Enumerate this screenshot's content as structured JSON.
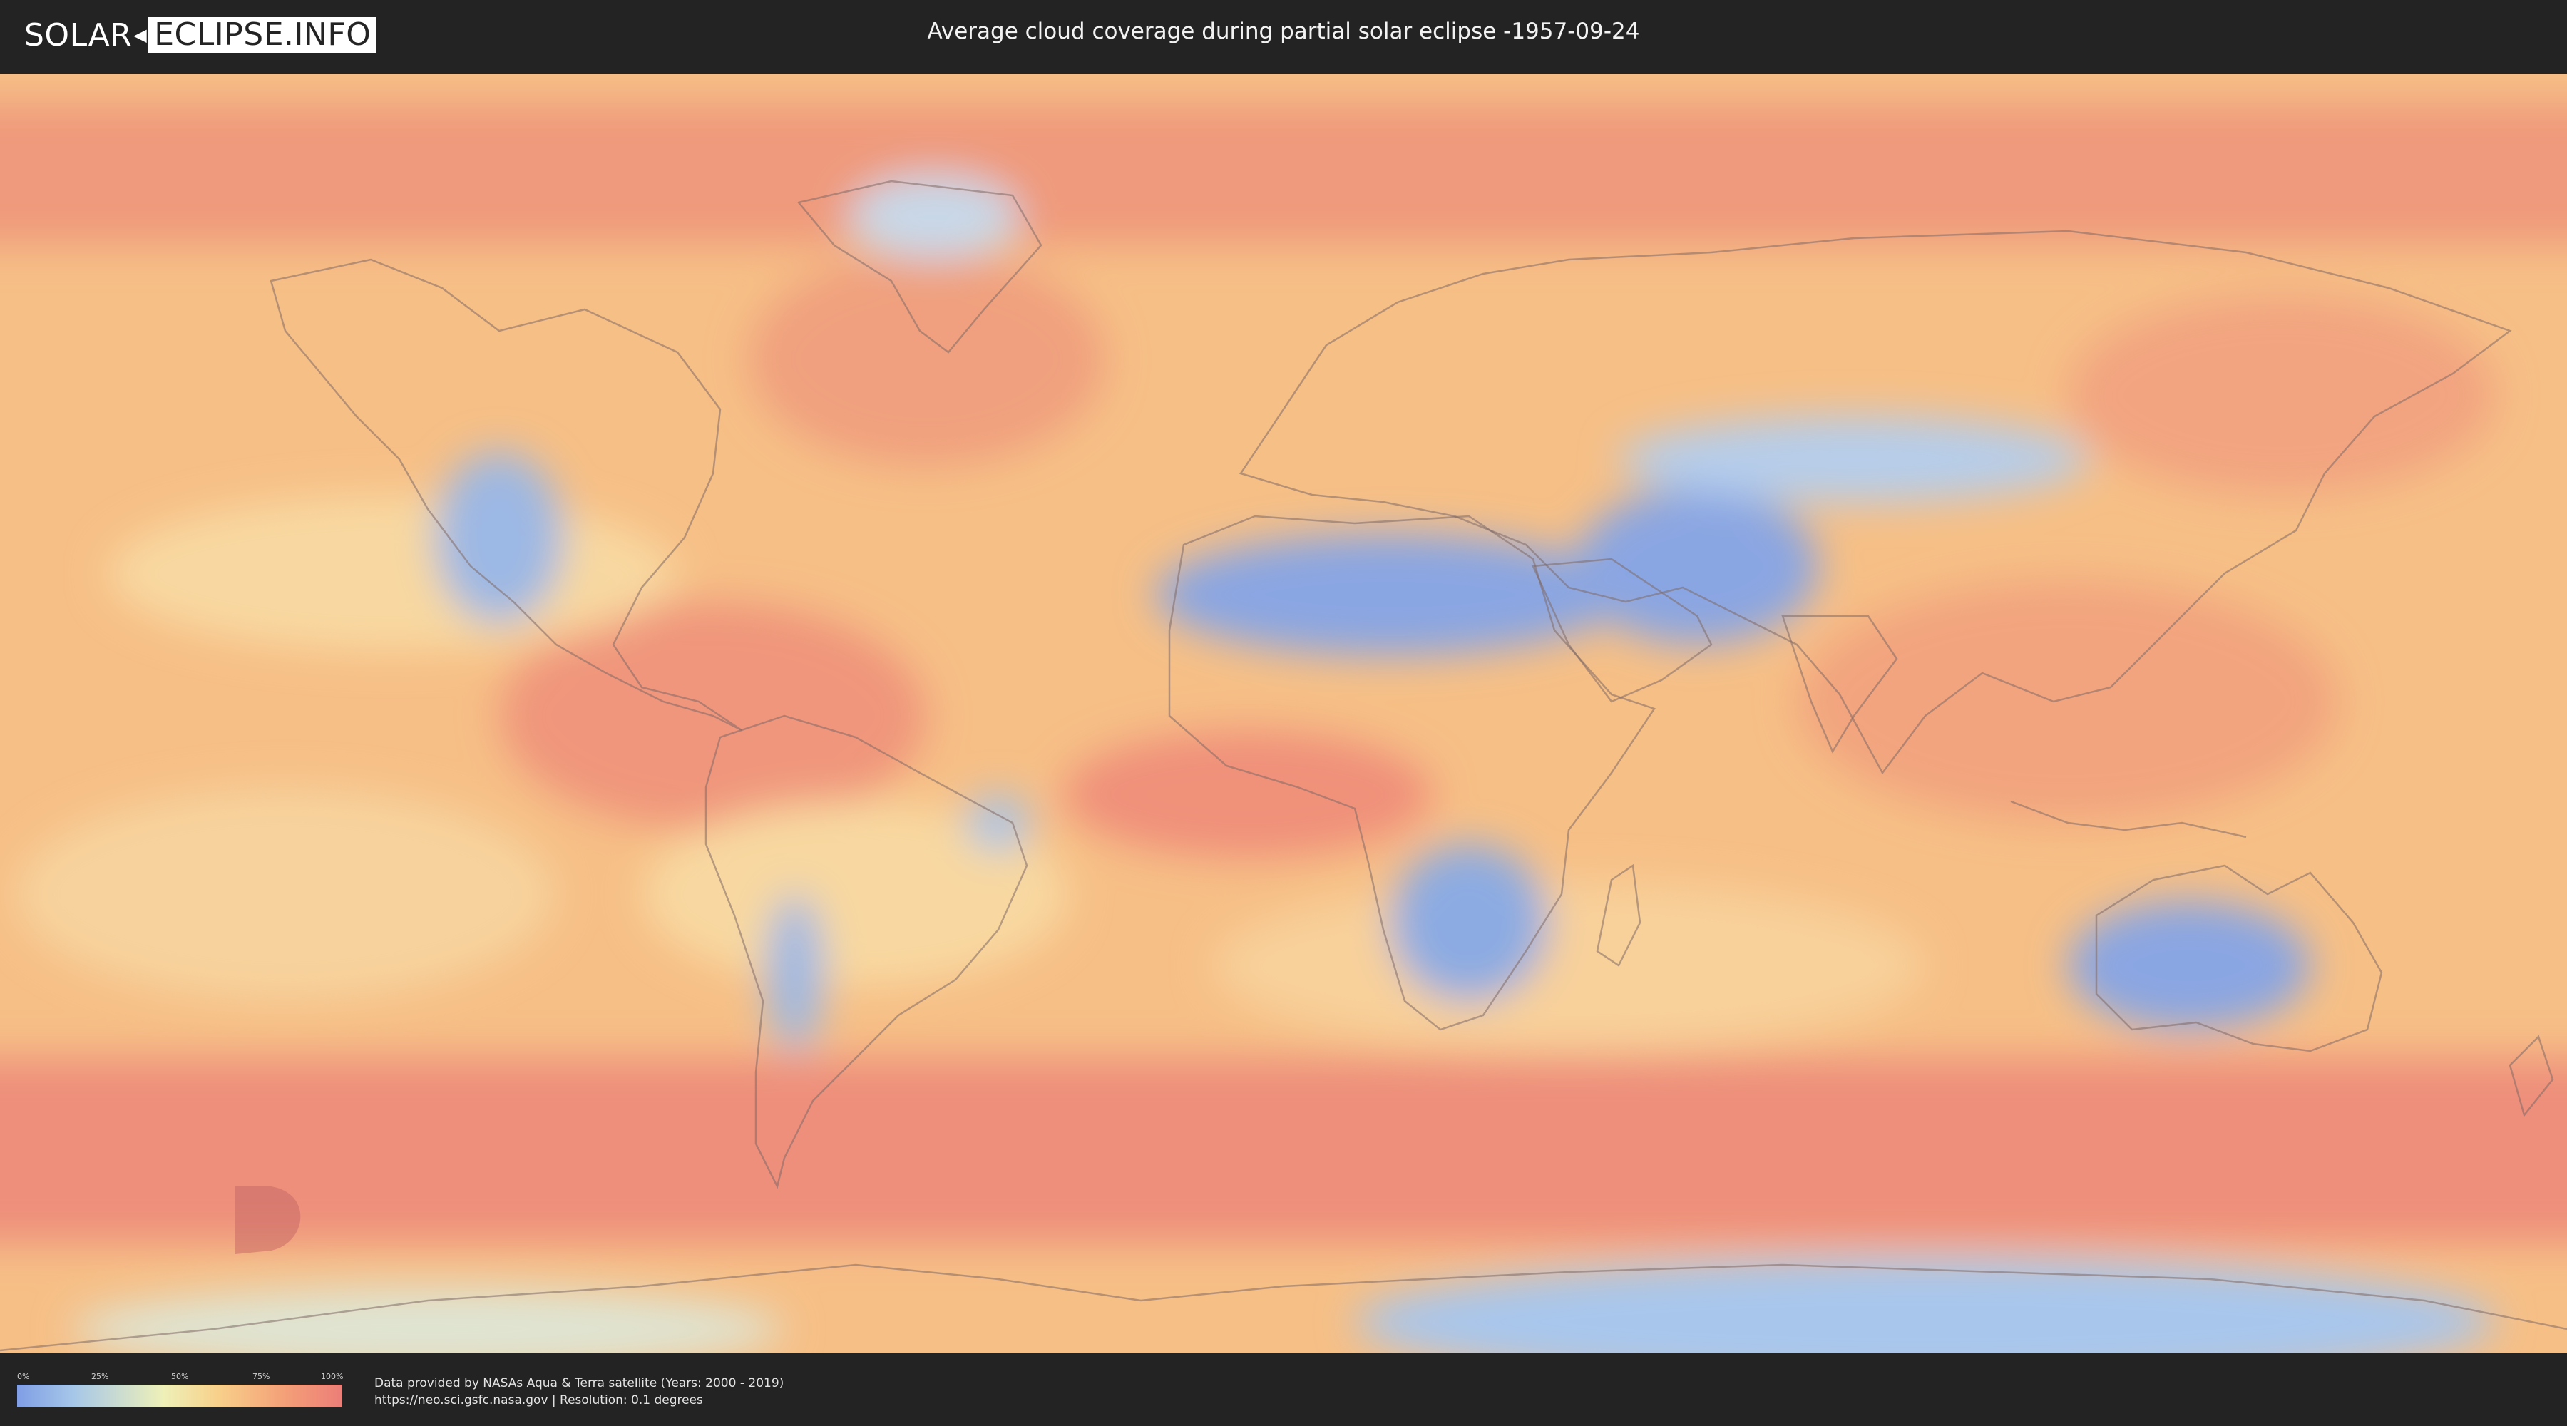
{
  "header": {
    "logo_left": "SOLAR",
    "logo_right": "ECLIPSE.INFO",
    "title": "Average cloud coverage during partial solar eclipse -1957-09-24"
  },
  "map": {
    "description_icon": "world-map",
    "colors": {
      "clear": "#7f9ee6",
      "low": "#a8c8e8",
      "mid": "#eef0b8",
      "high": "#f4a078",
      "overcast": "#ec7e78"
    }
  },
  "legend": {
    "ticks": [
      "0%",
      "25%",
      "50%",
      "75%",
      "100%"
    ]
  },
  "credits": {
    "line1": "Data provided by NASAs Aqua & Terra satellite (Years: 2000 - 2019)",
    "line2": "https://neo.sci.gsfc.nasa.gov | Resolution: 0.1 degrees"
  }
}
